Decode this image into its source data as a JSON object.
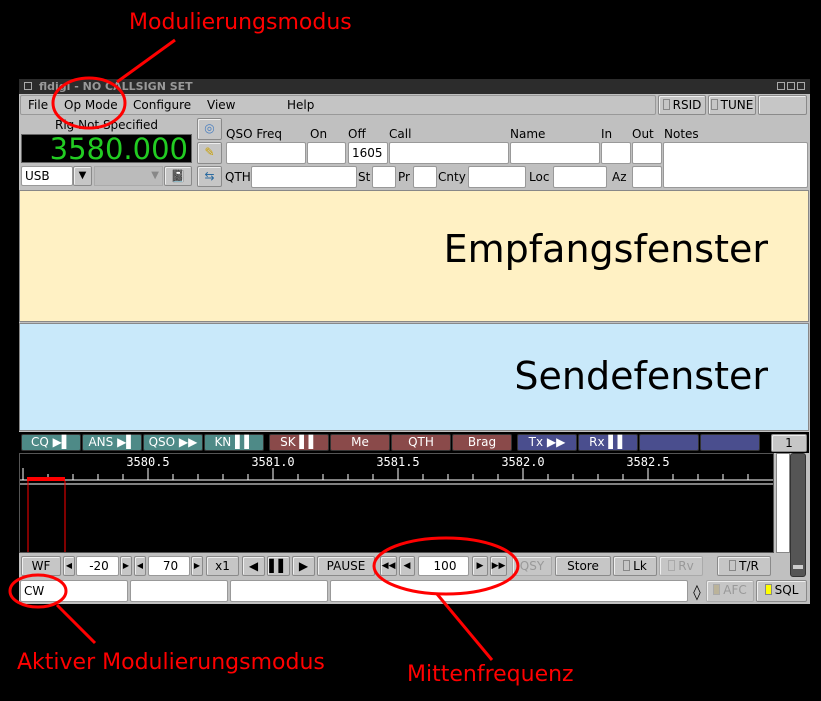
{
  "annotations": {
    "op_mode": "Modulierungsmodus",
    "active_mode": "Aktiver Modulierungsmodus",
    "center_freq": "Mittenfrequenz"
  },
  "window": {
    "title": "fldigi - NO CALLSIGN SET"
  },
  "menu": [
    "File",
    "Op Mode",
    "Configure",
    "View",
    "Help"
  ],
  "toggles": {
    "rsid": "RSID",
    "tune": "TUNE"
  },
  "rig": {
    "name": "Rig Not Specified",
    "frequency": "3580.000",
    "mode": "USB",
    "bandwidth": ""
  },
  "log": {
    "labels": {
      "qso_freq": "QSO Freq",
      "on": "On",
      "off": "Off",
      "call": "Call",
      "name": "Name",
      "in": "In",
      "out": "Out",
      "notes": "Notes",
      "qth": "QTH",
      "st": "St",
      "pr": "Pr",
      "cnty": "Cnty",
      "loc": "Loc",
      "az": "Az"
    },
    "values": {
      "qso_freq": "",
      "on": "",
      "off": "1605",
      "call": "",
      "name": "",
      "in": "",
      "out": "",
      "notes": "",
      "qth": "",
      "st": "",
      "pr": "",
      "cnty": "",
      "loc": "",
      "az": ""
    }
  },
  "panes": {
    "receive": "Empfangsfenster",
    "transmit": "Sendefenster"
  },
  "macros": [
    {
      "label": "CQ ▶▌",
      "color": "#4e8a87"
    },
    {
      "label": "ANS ▶▌",
      "color": "#4e8a87"
    },
    {
      "label": "QSO ▶▶",
      "color": "#4e8a87"
    },
    {
      "label": "KN ▌▌",
      "color": "#4e8a87"
    },
    {
      "label": "SK ▌▌",
      "color": "#8a4a4a"
    },
    {
      "label": "Me",
      "color": "#8a4a4a"
    },
    {
      "label": "QTH",
      "color": "#8a4a4a"
    },
    {
      "label": "Brag",
      "color": "#8a4a4a"
    },
    {
      "label": "Tx ▶▶",
      "color": "#4a4e8e"
    },
    {
      "label": "Rx ▌▌",
      "color": "#4a4e8e"
    },
    {
      "label": "",
      "color": "#4a4e8e"
    },
    {
      "label": "",
      "color": "#4a4e8e"
    }
  ],
  "macro_set": "1",
  "scale": {
    "ticks": [
      "3580.5",
      "3581.0",
      "3581.5",
      "3582.0",
      "3582.5"
    ]
  },
  "controls": {
    "wf": "WF",
    "min_db": "-20",
    "range_db": "70",
    "zoom": "x1",
    "pause": "PAUSE",
    "center": "100",
    "qsy": "QSY",
    "store": "Store",
    "lk": "Lk",
    "rv": "Rv",
    "tr": "T/R"
  },
  "status": {
    "mode": "CW",
    "afc": "AFC",
    "sql": "SQL"
  },
  "colors": {
    "annotation": "#ff0000",
    "freq_display": "#22cc22",
    "receive_bg": "#fff1c4",
    "transmit_bg": "#c9e9fa",
    "sql_led": "#ffff00"
  }
}
